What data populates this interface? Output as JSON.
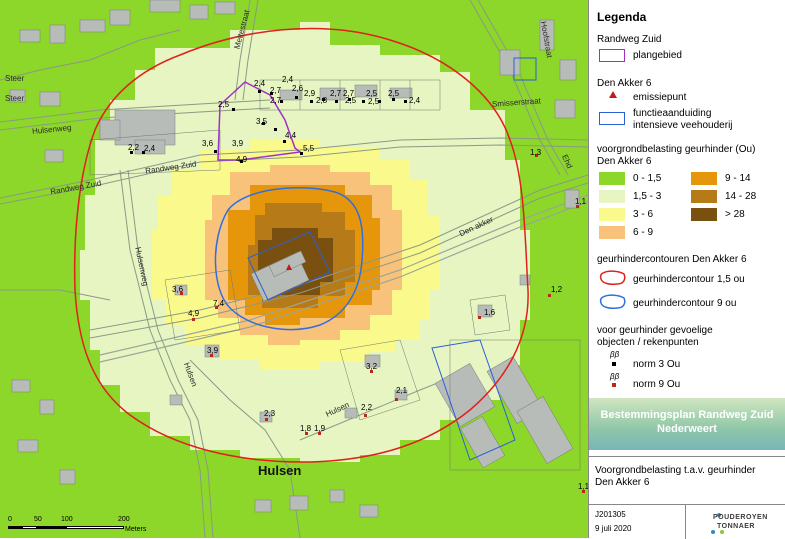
{
  "legend": {
    "title": "Legenda",
    "group_randweg": "Randweg Zuid",
    "plangebied": "plangebied",
    "group_denakker": "Den Akker 6",
    "emissiepunt": "emissiepunt",
    "functie_line1": "functieaanduiding",
    "functie_line2": "intensieve veehouderij",
    "voorgrond_title1": "voorgrondbelasting geurhinder (Ou)",
    "voorgrond_title2": "Den Akker 6",
    "classes": [
      {
        "label": "0 - 1,5",
        "color": "#8dd62a"
      },
      {
        "label": "1,5 - 3",
        "color": "#e6f5c2"
      },
      {
        "label": "3 - 6",
        "color": "#fafa8c"
      },
      {
        "label": "6 - 9",
        "color": "#f8c27a"
      },
      {
        "label": "9 - 14",
        "color": "#e6960a"
      },
      {
        "label": "14 - 28",
        "color": "#b67a18"
      },
      {
        "label": "> 28",
        "color": "#7a5010"
      }
    ],
    "contour_title": "geurhindercontouren Den Akker 6",
    "contour_15": "geurhindercontour 1,5 ou",
    "contour_9": "geurhindercontour 9 ou",
    "gevoelig_line1": "voor geurhinder gevoelige",
    "gevoelig_line2": "objecten / rekenpunten",
    "norm3": "norm 3 Ou",
    "norm9": "norm 9 Ou",
    "banner_line1": "Bestemmingsplan Randweg Zuid",
    "banner_line2": "Nederweert",
    "subtitle_line1": "Voorgrondbelasting t.a.v. geurhinder",
    "subtitle_line2": "Den Akker 6",
    "code": "J201305",
    "date": "9 juli 2020",
    "logo_line1": "POUDEROYEN",
    "logo_line2": "TONNAER"
  },
  "map": {
    "town_label": "Hulsen",
    "street_labels": [
      "Randweg Zuid",
      "Randweg Zuid",
      "Hulsenweg",
      "Smisserstraat",
      "Den akker",
      "Hulsenweg",
      "Hoofstraat",
      "Mettestraat",
      "Steer",
      "Steer",
      "Ehd",
      "Hulsen",
      "Hulsen"
    ],
    "scale_ticks": [
      "0",
      "50",
      "100",
      "200"
    ],
    "scale_unit": "Meters",
    "receptor_values": [
      {
        "v": "2,4"
      },
      {
        "v": "2,4"
      },
      {
        "v": "2,6"
      },
      {
        "v": "2,9"
      },
      {
        "v": "2,8"
      },
      {
        "v": "2,7"
      },
      {
        "v": "2,5"
      },
      {
        "v": "2,5"
      },
      {
        "v": "2,5"
      },
      {
        "v": "2,4"
      },
      {
        "v": "2,5"
      },
      {
        "v": "2,7"
      },
      {
        "v": "2,7"
      },
      {
        "v": "2,7"
      },
      {
        "v": "2,5"
      },
      {
        "v": "3,5"
      },
      {
        "v": "4,4"
      },
      {
        "v": "5,5"
      },
      {
        "v": "3,9"
      },
      {
        "v": "4,9"
      },
      {
        "v": "3,6"
      },
      {
        "v": "2,2"
      },
      {
        "v": "2,4"
      },
      {
        "v": "1,3"
      },
      {
        "v": "1,1"
      },
      {
        "v": "1,2"
      },
      {
        "v": "1,6"
      },
      {
        "v": "3,6"
      },
      {
        "v": "4,9"
      },
      {
        "v": "7,4"
      },
      {
        "v": "3,9"
      },
      {
        "v": "3,2"
      },
      {
        "v": "2,1"
      },
      {
        "v": "2,2"
      },
      {
        "v": "2,3"
      },
      {
        "v": "1,8"
      },
      {
        "v": "1,9"
      },
      {
        "v": "1,1"
      }
    ]
  }
}
